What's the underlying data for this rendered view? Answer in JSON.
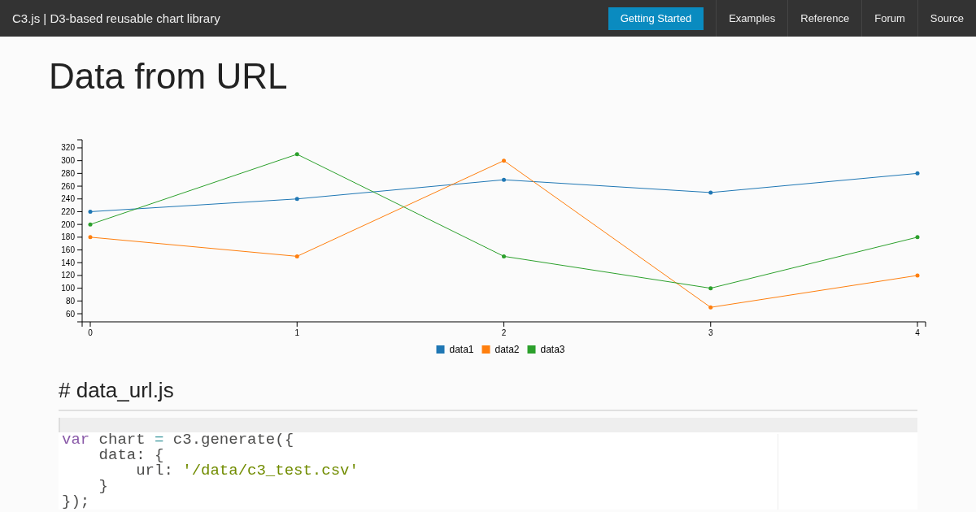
{
  "navbar": {
    "brand": "C3.js | D3-based reusable chart library",
    "links": [
      {
        "kind": "button",
        "label": "Getting Started"
      },
      {
        "kind": "link",
        "label": "Examples"
      },
      {
        "kind": "link",
        "label": "Reference"
      },
      {
        "kind": "link",
        "label": "Forum"
      },
      {
        "kind": "link",
        "label": "Source"
      }
    ]
  },
  "page_title": "Data from URL",
  "chart": {
    "chart_data": {
      "type": "line",
      "categories": [
        "0",
        "1",
        "2",
        "3",
        "4"
      ],
      "legend": true,
      "ylim": [
        47.3,
        332.7
      ],
      "yticks": [
        60,
        80,
        100,
        120,
        140,
        160,
        180,
        200,
        220,
        240,
        260,
        280,
        300,
        320
      ],
      "series": [
        {
          "name": "data1",
          "color": "#1f77b4",
          "values": [
            220,
            240,
            270,
            250,
            280
          ]
        },
        {
          "name": "data2",
          "color": "#ff7f0e",
          "values": [
            180,
            150,
            300,
            70,
            120
          ]
        },
        {
          "name": "data3",
          "color": "#2ca02c",
          "values": [
            200,
            310,
            150,
            100,
            180
          ]
        }
      ]
    }
  },
  "section_heading": "# data_url.js",
  "code": {
    "lines": [
      [
        {
          "kind": "keyword",
          "text": "var"
        },
        {
          "kind": "plain",
          "text": " chart "
        },
        {
          "kind": "operator",
          "text": "="
        },
        {
          "kind": "plain",
          "text": " c3.generate({"
        }
      ],
      [
        {
          "kind": "plain",
          "text": "    data: {"
        }
      ],
      [
        {
          "kind": "plain",
          "text": "        url: "
        },
        {
          "kind": "string",
          "text": "'/data/c3_test.csv'"
        }
      ],
      [
        {
          "kind": "plain",
          "text": "    }"
        }
      ],
      [
        {
          "kind": "plain",
          "text": "});"
        }
      ]
    ]
  }
}
